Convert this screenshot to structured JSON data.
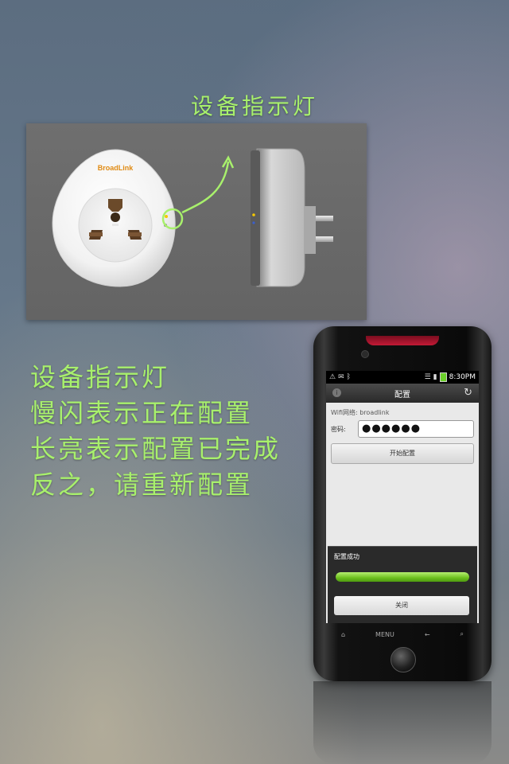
{
  "header": {
    "title": "设备指示灯"
  },
  "photo": {
    "brand_logo": "BroadLink"
  },
  "description": {
    "lines": [
      "设备指示灯",
      "慢闪表示正在配置",
      "长亮表示配置已完成",
      "反之，请重新配置"
    ]
  },
  "phone": {
    "statusbar": {
      "time": "8:30PM"
    },
    "app_title": "配置",
    "wifi_label": "Wifi网络: broadlink",
    "password_label": "密码:",
    "password_value": "●●●●●●",
    "start_button": "开始配置",
    "dialog": {
      "title": "配置成功",
      "progress": 1.0,
      "close_button": "关闭"
    },
    "nav": {
      "menu_label": "MENU"
    }
  },
  "colors": {
    "accent_green": "#a8f06c",
    "progress_green": "#6cbf1d"
  }
}
